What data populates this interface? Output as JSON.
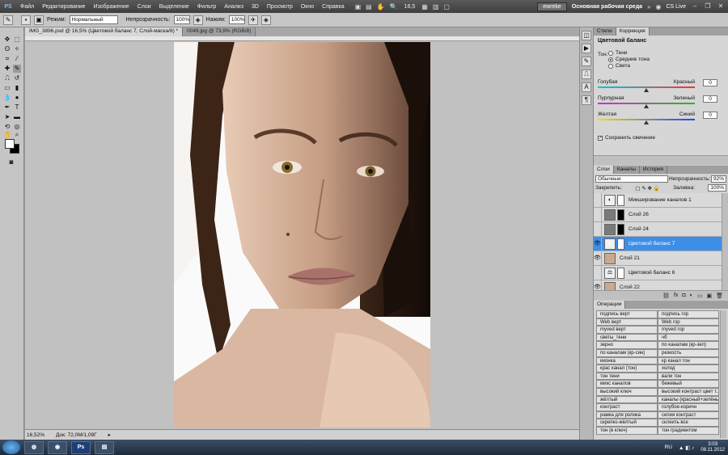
{
  "app": {
    "logo": "PS",
    "menu": [
      "Файл",
      "Редактирование",
      "Изображение",
      "Слои",
      "Выделение",
      "Фильтр",
      "Анализ",
      "3D",
      "Просмотр",
      "Окно",
      "Справка"
    ],
    "zoom_menu": "16,5",
    "profile": "ewreke",
    "workspace": "Основная рабочая среда",
    "cs_live": "CS Live"
  },
  "options": {
    "mode_label": "Режим:",
    "mode_value": "Нормальный",
    "opacity_label": "Непрозрачность:",
    "opacity_value": "100%",
    "pressure_label": "Нажим:",
    "pressure_value": "100%"
  },
  "documents": {
    "tabs": [
      "IMG_3896.psd @ 16,5% (Цветовой баланс 7, Слой-маска/8) *",
      "0049.jpg @ 73,9% (RGB/8)"
    ],
    "status_zoom": "16,52%",
    "status_doc": "Док: 72,0M/1,09Г"
  },
  "adjustments": {
    "tabs": [
      "Стили",
      "Коррекция"
    ],
    "title": "Цветовой баланс",
    "tone_label": "Тон:",
    "tone_options": [
      "Тени",
      "Средние тона",
      "Света"
    ],
    "tone_selected": 1,
    "sliders": [
      {
        "left": "Голубая",
        "right": "Красный",
        "value": "0",
        "position": 0.5,
        "colors": [
          "#00c8e0",
          "#ff3030"
        ]
      },
      {
        "left": "Пурпурная",
        "right": "Зеленый",
        "value": "0",
        "position": 0.5,
        "colors": [
          "#e020e0",
          "#20c020"
        ]
      },
      {
        "left": "Желтая",
        "right": "Синий",
        "value": "0",
        "position": 0.5,
        "colors": [
          "#f0e000",
          "#2040ff"
        ]
      }
    ],
    "preserve_luminosity": "Сохранить свечение"
  },
  "layers": {
    "tabs": [
      "Слои",
      "Каналы",
      "История"
    ],
    "blend_mode": "Обычные",
    "opacity_label": "Непрозрачность:",
    "opacity_value": "92%",
    "lock_label": "Закрепить:",
    "fill_label": "Заливка:",
    "fill_value": "100%",
    "items": [
      {
        "name": "Микширование каналов 1",
        "visible": false,
        "thumb": "◐",
        "thumb_color": "#f0f0f0",
        "mask": "#ffffff",
        "selected": false
      },
      {
        "name": "Слой 26",
        "visible": false,
        "thumb": "",
        "thumb_color": "#7a7a7a",
        "mask": "#000000",
        "selected": false
      },
      {
        "name": "Слой 24",
        "visible": false,
        "thumb": "",
        "thumb_color": "#7a7a7a",
        "mask": "#000000",
        "selected": false
      },
      {
        "name": "Цветовой баланс 7",
        "visible": true,
        "thumb": "⚖",
        "thumb_color": "#f0f0f0",
        "mask": "#ffffff",
        "selected": true
      },
      {
        "name": "Слой 21",
        "visible": true,
        "thumb": "",
        "thumb_color": "#c9a98f",
        "mask": "",
        "selected": false
      },
      {
        "name": "Цветовой баланс 6",
        "visible": false,
        "thumb": "⚖",
        "thumb_color": "#f0f0f0",
        "mask": "#ffffff",
        "selected": false
      },
      {
        "name": "Слой 22",
        "visible": true,
        "thumb": "",
        "thumb_color": "#c9a98f",
        "mask": "",
        "selected": false
      }
    ]
  },
  "actions": {
    "tab": "Операции",
    "rows": [
      [
        "подпись верт",
        "подпись гор"
      ],
      [
        "Web верт",
        "Web гор"
      ],
      [
        "myved верт",
        "myved гор"
      ],
      [
        "светы_тени",
        "чб"
      ],
      [
        "зерно",
        "по каналам (кр-зел)"
      ],
      [
        "по каналам (кр-син)",
        "резкость"
      ],
      [
        "иконка",
        "кр канал тон"
      ],
      [
        "крас канал (тон)",
        "холод"
      ],
      [
        "тон тени",
        "вали тон"
      ],
      [
        "микс каналов",
        "бежевый"
      ],
      [
        "высокий ключ",
        "высокий контраст цвет т..."
      ],
      [
        "жёлтый",
        "каналы (красный+зелёный)"
      ],
      [
        "контраст",
        "голубое-коричн"
      ],
      [
        "рамка для ролика",
        "сепия контраст"
      ],
      [
        "скрепко-жёлтый",
        "склеить все"
      ],
      [
        "тон (в ключ)",
        "тон градиентом"
      ]
    ]
  },
  "taskbar": {
    "apps": [
      "Chrome",
      "Camera",
      "Ps",
      "Folder"
    ],
    "language": "RU",
    "time": "3:03",
    "date": "08.11.2012"
  }
}
